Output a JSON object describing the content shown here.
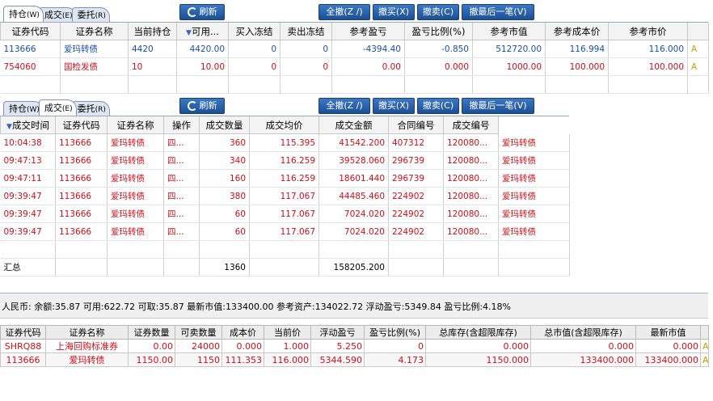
{
  "tabs": {
    "holdings": "持仓",
    "holdings_key": "(W)",
    "trades": "成交",
    "trades_key": "(E)",
    "orders": "委托",
    "orders_key": "(R)"
  },
  "buttons": {
    "refresh": "刷新",
    "cancel_all": "全撤(Z /)",
    "cancel_buy": "撤买(X)",
    "cancel_sell": "撤卖(C)",
    "cancel_last": "撤最后一笔(V)"
  },
  "holdings": {
    "headers": [
      "证券代码",
      "证券名称",
      "当前持仓",
      "可用...",
      "买入冻结",
      "卖出冻结",
      "参考盈亏",
      "盈亏比例(%)",
      "参考市值",
      "参考成本价",
      "参考市价"
    ],
    "sort_mark": "▼",
    "rows": [
      {
        "code": "113666",
        "name": "爱玛转债",
        "position": "4420",
        "available": "4420.00",
        "buy_frozen": "0",
        "sell_frozen": "0",
        "pnl": "-4394.40",
        "pnl_ratio": "-0.850",
        "market_value": "512720.00",
        "cost": "116.994",
        "price": "116.000",
        "extra": "A"
      },
      {
        "code": "754060",
        "name": "国检发债",
        "position": "10",
        "available": "10.00",
        "buy_frozen": "0",
        "sell_frozen": "0",
        "pnl": "0.00",
        "pnl_ratio": "0.000",
        "market_value": "1000.00",
        "cost": "100.000",
        "price": "100.000",
        "extra": "A"
      }
    ]
  },
  "trades": {
    "headers": [
      "成交时间",
      "证券代码",
      "证券名称",
      "操作",
      "成交数量",
      "成交均价",
      "成交金额",
      "合同编号",
      "成交编号",
      ""
    ],
    "sort_mark": "▼",
    "rows": [
      {
        "time": "10:04:38",
        "code": "113666",
        "name": "爱玛转债",
        "op": "四...",
        "qty": "360",
        "avg": "115.395",
        "amount": "41542.200",
        "contract": "407312",
        "trade_no": "120080...",
        "extra": "爱玛转债"
      },
      {
        "time": "09:47:13",
        "code": "113666",
        "name": "爱玛转债",
        "op": "四...",
        "qty": "340",
        "avg": "116.259",
        "amount": "39528.060",
        "contract": "296739",
        "trade_no": "120080...",
        "extra": "爱玛转债"
      },
      {
        "time": "09:47:11",
        "code": "113666",
        "name": "爱玛转债",
        "op": "四...",
        "qty": "160",
        "avg": "116.259",
        "amount": "18601.440",
        "contract": "296739",
        "trade_no": "120080...",
        "extra": "爱玛转债"
      },
      {
        "time": "09:39:47",
        "code": "113666",
        "name": "爱玛转债",
        "op": "四...",
        "qty": "380",
        "avg": "117.067",
        "amount": "44485.460",
        "contract": "224902",
        "trade_no": "120080...",
        "extra": "爱玛转债"
      },
      {
        "time": "09:39:47",
        "code": "113666",
        "name": "爱玛转债",
        "op": "四...",
        "qty": "60",
        "avg": "117.067",
        "amount": "7024.020",
        "contract": "224902",
        "trade_no": "120080...",
        "extra": "爱玛转债"
      },
      {
        "time": "09:39:47",
        "code": "113666",
        "name": "爱玛转债",
        "op": "四...",
        "qty": "60",
        "avg": "117.067",
        "amount": "7024.020",
        "contract": "224902",
        "trade_no": "120080...",
        "extra": "爱玛转债"
      }
    ],
    "total_label": "汇总",
    "total_qty": "1360",
    "total_amount": "158205.200"
  },
  "summary": "人民币:  余额:35.87  可用:622.72  可取:35.87  最新市值:133400.00  参考资产:134022.72  浮动盈亏:5349.84  盈亏比例:4.18%",
  "bottom": {
    "headers": [
      "证券代码",
      "证券名称",
      "证券数量",
      "可卖数量",
      "成本价",
      "当前价",
      "浮动盈亏",
      "盈亏比例(%)",
      "总库存(含超限库存)",
      "总市值(含超限库存)",
      "最新市值"
    ],
    "rows": [
      {
        "code": "SHRQ88",
        "name": "上海回购标准券",
        "qty": "0.00",
        "sellable": "24000",
        "cost": "0.000",
        "price": "1.000",
        "pnl": "5.250",
        "ratio": "0",
        "stock": "0.000",
        "total_value": "0.000",
        "latest": "0.000",
        "extra": "A"
      },
      {
        "code": "113666",
        "name": "爱玛转债",
        "qty": "1150.00",
        "sellable": "1150",
        "cost": "111.353",
        "price": "116.000",
        "pnl": "5344.590",
        "ratio": "4.173",
        "stock": "1150.000",
        "total_value": "133400.000",
        "latest": "133400.000",
        "extra": "A"
      }
    ]
  }
}
